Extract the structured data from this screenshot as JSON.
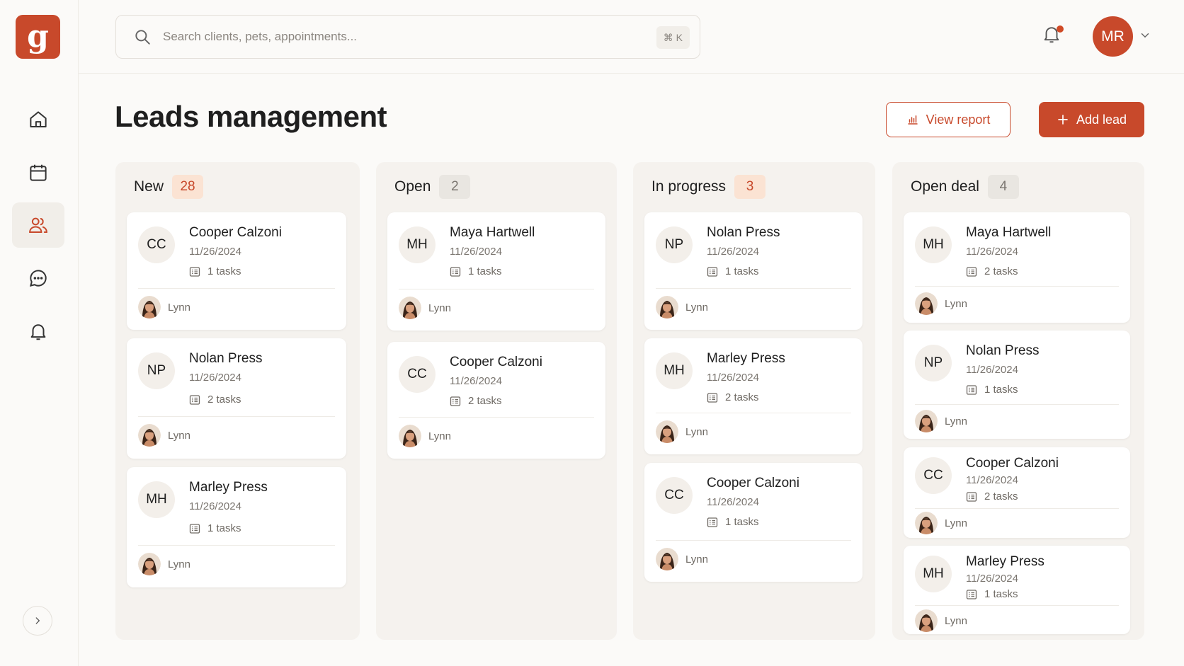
{
  "app": {
    "logo_letter": "g",
    "brand_color": "#c8492b"
  },
  "sidebar": {
    "items": [
      {
        "icon": "home-icon",
        "active": false
      },
      {
        "icon": "calendar-icon",
        "active": false
      },
      {
        "icon": "users-icon",
        "active": true
      },
      {
        "icon": "chat-icon",
        "active": false
      },
      {
        "icon": "bell-icon",
        "active": false
      }
    ],
    "expand_icon": "chevron-right-icon"
  },
  "header": {
    "search_placeholder": "Search clients, pets, appointments...",
    "search_shortcut": "⌘ K",
    "user_initials": "MR"
  },
  "page": {
    "title": "Leads management",
    "view_report_label": "View report",
    "add_lead_label": "Add lead"
  },
  "columns": [
    {
      "title": "New",
      "count": "28",
      "cards": [
        {
          "initials": "CC",
          "name": "Cooper Calzoni",
          "date": "11/26/2024",
          "tasks": "1 tasks",
          "assignee": "Lynn"
        },
        {
          "initials": "NP",
          "name": "Nolan Press",
          "date": "11/26/2024",
          "tasks": "2 tasks",
          "assignee": "Lynn"
        },
        {
          "initials": "MH",
          "name": "Marley Press",
          "date": "11/26/2024",
          "tasks": "1 tasks",
          "assignee": "Lynn"
        }
      ]
    },
    {
      "title": "Open",
      "count": "2",
      "cards": [
        {
          "initials": "MH",
          "name": "Maya Hartwell",
          "date": "11/26/2024",
          "tasks": "1 tasks",
          "assignee": "Lynn"
        },
        {
          "initials": "CC",
          "name": "Cooper Calzoni",
          "date": "11/26/2024",
          "tasks": "2 tasks",
          "assignee": "Lynn"
        }
      ]
    },
    {
      "title": "In progress",
      "count": "3",
      "cards": [
        {
          "initials": "NP",
          "name": "Nolan Press",
          "date": "11/26/2024",
          "tasks": "1 tasks",
          "assignee": "Lynn"
        },
        {
          "initials": "MH",
          "name": "Marley Press",
          "date": "11/26/2024",
          "tasks": "2 tasks",
          "assignee": "Lynn"
        },
        {
          "initials": "CC",
          "name": "Cooper Calzoni",
          "date": "11/26/2024",
          "tasks": "1 tasks",
          "assignee": "Lynn"
        }
      ]
    },
    {
      "title": "Open deal",
      "count": "4",
      "cards": [
        {
          "initials": "MH",
          "name": "Maya Hartwell",
          "date": "11/26/2024",
          "tasks": "2 tasks",
          "assignee": "Lynn"
        },
        {
          "initials": "NP",
          "name": "Nolan Press",
          "date": "11/26/2024",
          "tasks": "1 tasks",
          "assignee": "Lynn"
        },
        {
          "initials": "CC",
          "name": "Cooper Calzoni",
          "date": "11/26/2024",
          "tasks": "2 tasks",
          "assignee": "Lynn"
        },
        {
          "initials": "MH",
          "name": "Marley Press",
          "date": "11/26/2024",
          "tasks": "1 tasks",
          "assignee": "Lynn"
        }
      ]
    }
  ]
}
